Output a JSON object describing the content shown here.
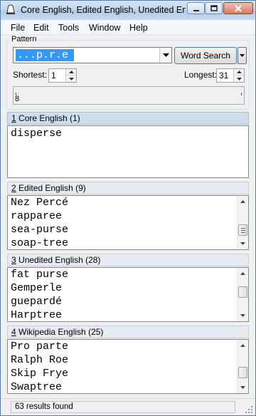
{
  "window": {
    "title": "Core English, Edited English, Unedited En..."
  },
  "menu": [
    "File",
    "Edit",
    "Tools",
    "Window",
    "Help"
  ],
  "pattern": {
    "legend": "Pattern",
    "value": "...p.r.e",
    "word_search_label": "Word Search",
    "shortest_label": "Shortest:",
    "shortest_value": "1",
    "longest_label": "Longest:",
    "longest_value": "31",
    "slider_label": "8"
  },
  "sections": [
    {
      "num": "1",
      "title": " Core English (1)",
      "items": [
        "disperse"
      ]
    },
    {
      "num": "2",
      "title": " Edited English (9)",
      "items": [
        "Nez Percé",
        "rapparee",
        "sea-purse",
        "soap-tree"
      ]
    },
    {
      "num": "3",
      "title": " Unedited English (28)",
      "items": [
        "fat purse",
        "Gemperle",
        "guepardé",
        "Harptree"
      ]
    },
    {
      "num": "4",
      "title": " Wikipedia English (25)",
      "items": [
        "Pro parte",
        "Ralph Roe",
        "Skip Frye",
        "Swaptree"
      ]
    }
  ],
  "status": {
    "text": "63 results found"
  },
  "icons": {
    "app": "bell-icon",
    "minimize": "minimize-icon",
    "maximize": "maximize-icon",
    "close": "close-icon"
  }
}
